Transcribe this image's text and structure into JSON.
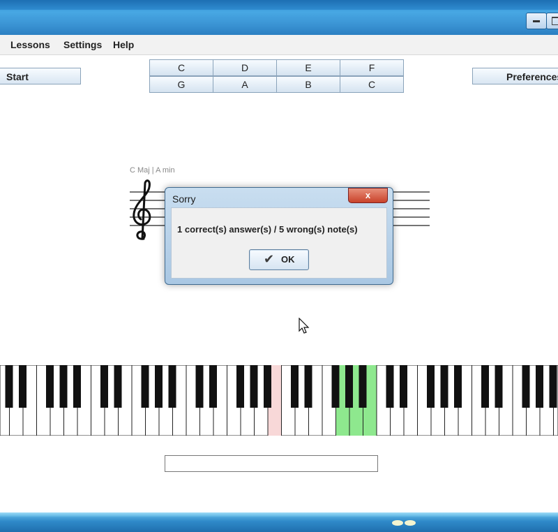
{
  "menu": {
    "items": [
      "Lessons",
      "Settings",
      "Help"
    ]
  },
  "toolbar": {
    "start_label": "Start",
    "preferences_label": "Preferences"
  },
  "note_buttons": {
    "row1": [
      "C",
      "D",
      "E",
      "F"
    ],
    "row2": [
      "G",
      "A",
      "B",
      "C"
    ]
  },
  "staff": {
    "caption": "C Maj | A min",
    "clef_icon": "treble-clef-icon"
  },
  "dialog": {
    "title": "Sorry",
    "close_label": "x",
    "message": "1 correct(s) answer(s) / 5 wrong(s) note(s)",
    "ok_label": "OK",
    "ok_icon": "checkmark-icon"
  },
  "keyboard": {
    "highlight_colors": {
      "wrong": "#f8d8d8",
      "correct": "#8ee88e"
    }
  },
  "colors": {
    "titlebar": "#3b94d4",
    "dialog_border": "#3f6a8f",
    "close_button": "#c9422a"
  }
}
